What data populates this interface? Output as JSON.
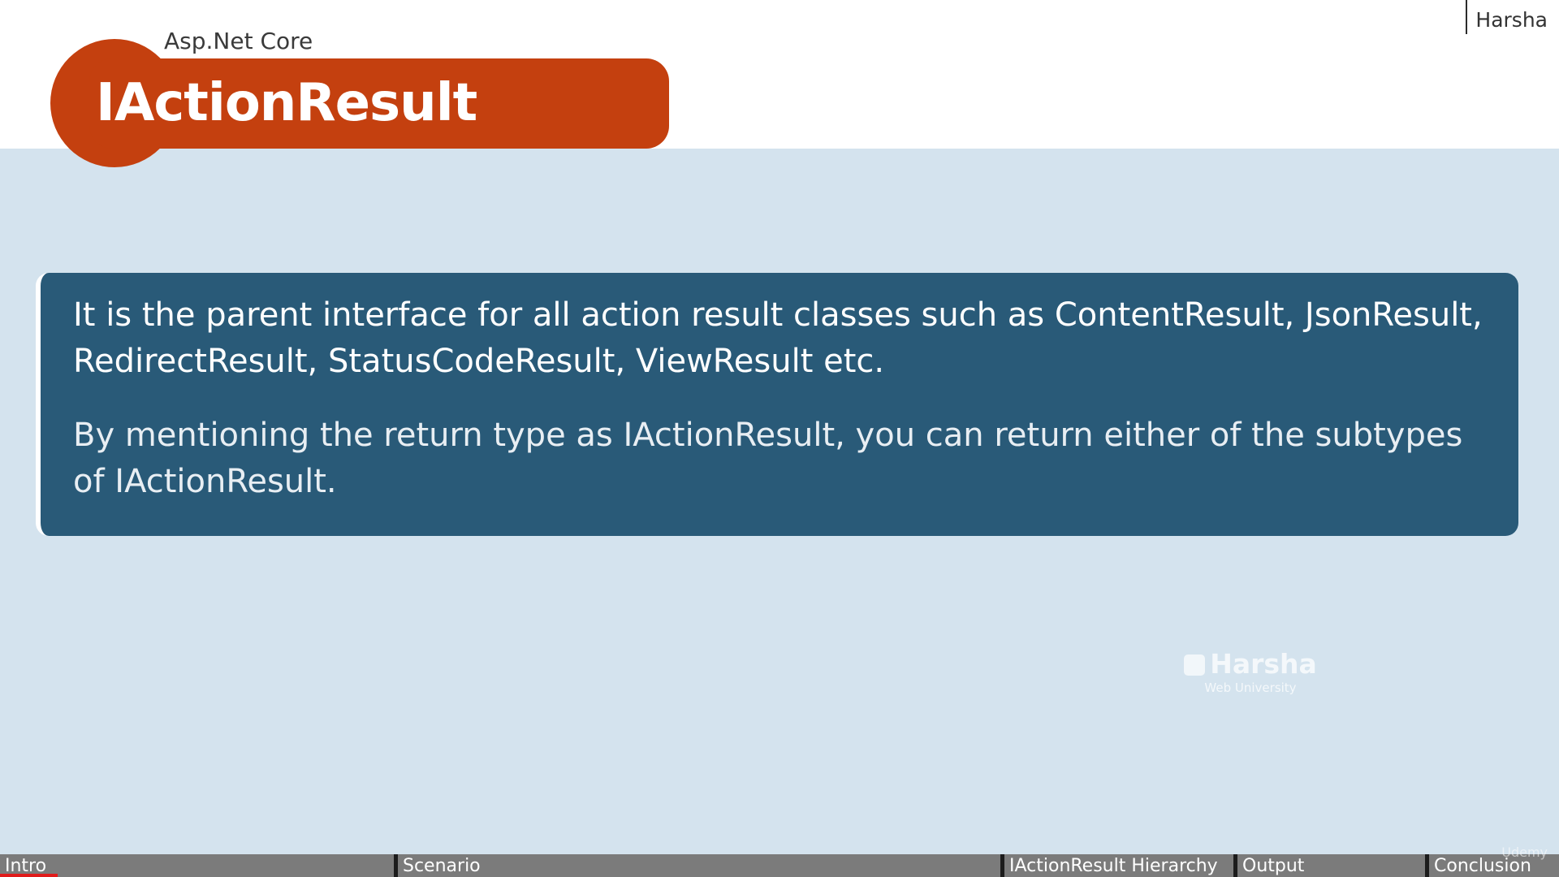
{
  "header": {
    "author": "Harsha",
    "subtitle": "Asp.Net Core",
    "title": "IActionResult"
  },
  "card": {
    "paragraph1": "It is the parent interface for all action result classes such as ContentResult, JsonResult, RedirectResult, StatusCodeResult, ViewResult etc.",
    "paragraph2": "By mentioning the return type as IActionResult, you can return either of the subtypes of IActionResult."
  },
  "watermark": {
    "brand": "Harsha",
    "sub": "Web University"
  },
  "chapters": [
    {
      "label": "Intro"
    },
    {
      "label": "Scenario"
    },
    {
      "label": "IActionResult Hierarchy"
    },
    {
      "label": "Output"
    },
    {
      "label": "Conclusion"
    }
  ],
  "player": {
    "platform": "Udemy",
    "progress_fraction": 0.037
  },
  "colors": {
    "accent": "#c4400f",
    "card": "#295a78",
    "background": "#d4e3ee",
    "chapter_bar": "#7b7b7b",
    "progress": "#e01b1b"
  }
}
